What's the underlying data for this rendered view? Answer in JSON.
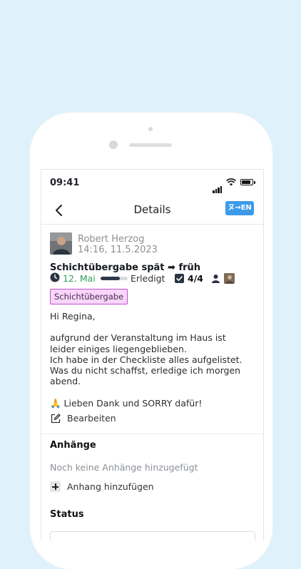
{
  "status_bar": {
    "time": "09:41"
  },
  "nav": {
    "title": "Details",
    "translate_label": "ヌ→EN"
  },
  "author": {
    "name": "Robert Herzog",
    "timestamp": "14:16, 11.5.2023"
  },
  "task": {
    "title": "Schichtübergabe spät ➡ früh",
    "due_date": "12. Mai",
    "progress_fraction": 0.7,
    "progress_label": "Erledigt",
    "checklist_count": "4/4",
    "tag": "Schichtübergabe"
  },
  "message": {
    "line1": "Hi Regina,",
    "line2": "aufgrund der Veranstaltung im Haus ist",
    "line3": "leider einiges liegengeblieben.",
    "line4": "Ich habe in der Checkliste alles aufgelistet.",
    "line5": "Was du nicht schaffst, erledige ich morgen",
    "line6": "abend.",
    "line7": "🙏 Lieben Dank und SORRY dafür!"
  },
  "edit_label": "Bearbeiten",
  "attachments": {
    "heading": "Anhänge",
    "empty_text": "Noch keine Anhänge hinzugefügt",
    "add_label": "Anhang hinzufügen"
  },
  "status": {
    "heading": "Status"
  },
  "colors": {
    "accent": "#3d9ae8",
    "date_green": "#2f9e5b",
    "tag_border": "#c04fd1",
    "tag_fill": "#f7d6f9"
  },
  "icons": [
    "chevron-left-icon",
    "clock-icon",
    "checkbox-icon",
    "person-icon",
    "edit-icon",
    "plus-icon",
    "signal-icon",
    "wifi-icon",
    "battery-icon"
  ]
}
